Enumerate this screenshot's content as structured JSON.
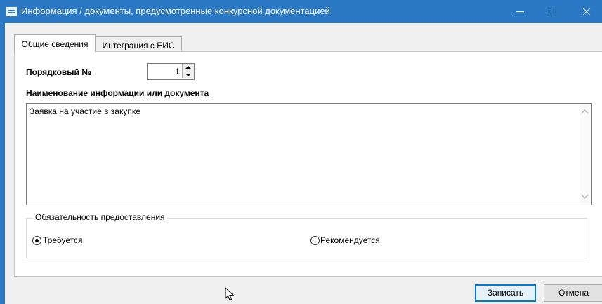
{
  "window": {
    "title": "Информация / документы, предусмотренные конкурсной документацией",
    "accent": "#2b78c5"
  },
  "tabs": [
    {
      "label": "Общие сведения",
      "active": true
    },
    {
      "label": "Интеграция с ЕИС",
      "active": false
    }
  ],
  "form": {
    "number_label": "Порядковый №",
    "number_value": "1",
    "name_label": "Наименование информации или документа",
    "name_value": "Заявка на участие в закупке"
  },
  "requirement_group": {
    "title": "Обязательность предоставления",
    "options": [
      {
        "label": "Требуется",
        "selected": true
      },
      {
        "label": "Рекомендуется",
        "selected": false
      }
    ]
  },
  "buttons": {
    "save": "Записать",
    "cancel": "Отмена"
  },
  "icons": {
    "app": "form-window-icon",
    "minimize": "minimize-icon",
    "maximize": "maximize-icon",
    "close": "close-icon",
    "cursor": "mouse-pointer-icon"
  }
}
